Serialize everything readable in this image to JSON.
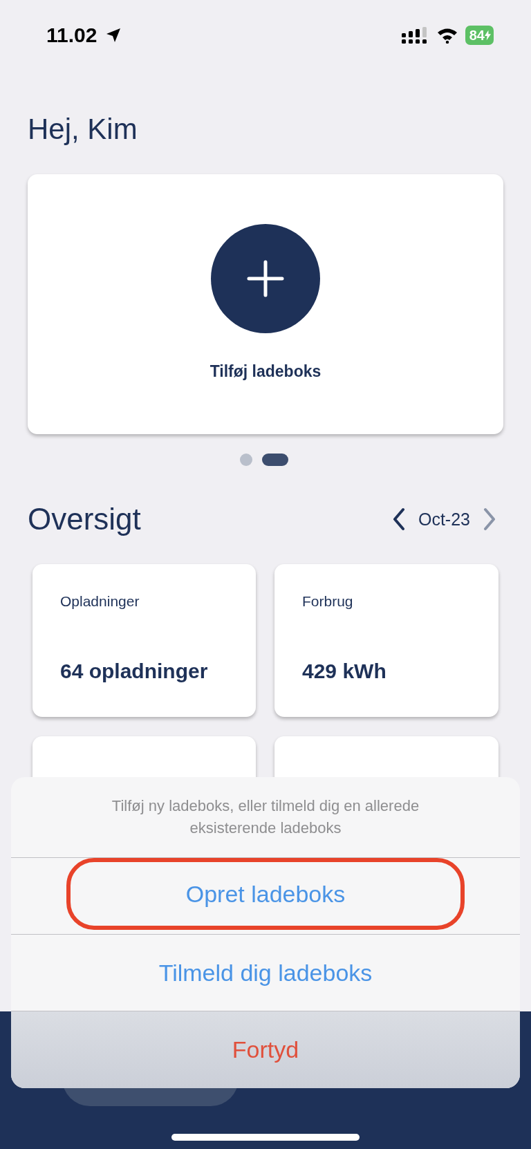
{
  "status_bar": {
    "time": "11.02",
    "battery": "84"
  },
  "greeting": "Hej, Kim",
  "add_card": {
    "label": "Tilføj ladeboks"
  },
  "pager": [
    {
      "selected": false
    },
    {
      "selected": true
    }
  ],
  "overview": {
    "title": "Oversigt",
    "period": "Oct-23"
  },
  "stats": [
    {
      "label": "Opladninger",
      "value": "64 opladninger"
    },
    {
      "label": "Forbrug",
      "value": "429 kWh"
    }
  ],
  "action_sheet": {
    "message": "Tilføj ny ladeboks, eller tilmeld dig en allerede eksisterende ladeboks",
    "actions": [
      {
        "label": "Opret ladeboks",
        "kind": "default",
        "highlighted": true
      },
      {
        "label": "Tilmeld dig ladeboks",
        "kind": "default",
        "highlighted": false
      },
      {
        "label": "Fortyd",
        "kind": "cancel",
        "highlighted": false
      }
    ]
  }
}
